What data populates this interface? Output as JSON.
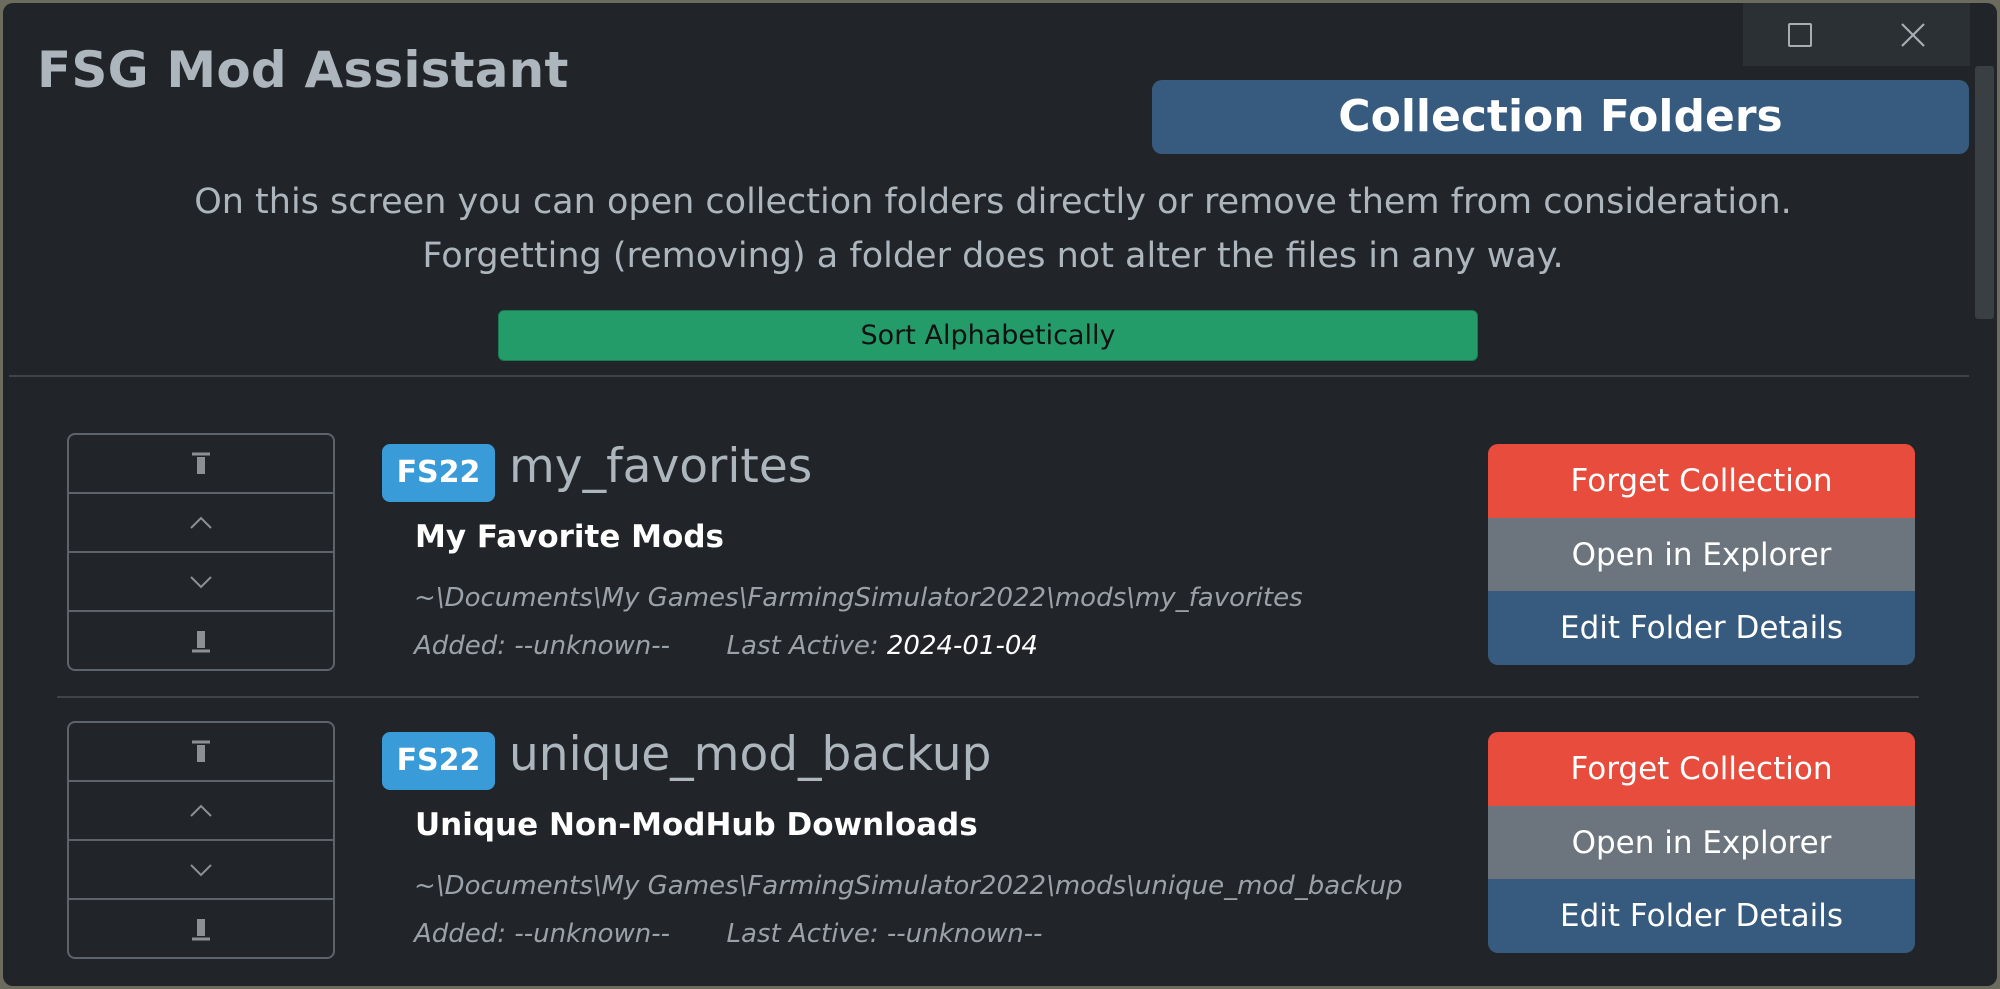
{
  "window": {
    "controls": {
      "maximize": "maximize-icon",
      "close": "close-icon"
    }
  },
  "app": {
    "title": "FSG Mod Assistant"
  },
  "page": {
    "heading": "Collection Folders",
    "intro": "On this screen you can open collection folders directly or remove them from consideration. Forgetting (removing) a folder does not alter the files in any way.",
    "sort_label": "Sort Alphabetically"
  },
  "labels": {
    "added": "Added:",
    "last_active": "Last Active:",
    "forget": "Forget Collection",
    "open": "Open in Explorer",
    "edit": "Edit Folder Details"
  },
  "move_icons": [
    "move-top-icon",
    "move-up-icon",
    "move-down-icon",
    "move-bottom-icon"
  ],
  "collections": [
    {
      "game": "FS22",
      "name": "my_favorites",
      "description": "My Favorite Mods",
      "path": "~\\Documents\\My Games\\FarmingSimulator2022\\mods\\my_favorites",
      "added": "--unknown--",
      "last_active": "2024-01-04"
    },
    {
      "game": "FS22",
      "name": "unique_mod_backup",
      "description": "Unique Non-ModHub Downloads",
      "path": "~\\Documents\\My Games\\FarmingSimulator2022\\mods\\unique_mod_backup",
      "added": "--unknown--",
      "last_active": "--unknown--"
    }
  ],
  "colors": {
    "background": "#212529",
    "primary": "#375a7f",
    "success": "#239c6a",
    "danger": "#e74c3c",
    "secondary": "#6c757d",
    "badge": "#3a9bd9"
  }
}
